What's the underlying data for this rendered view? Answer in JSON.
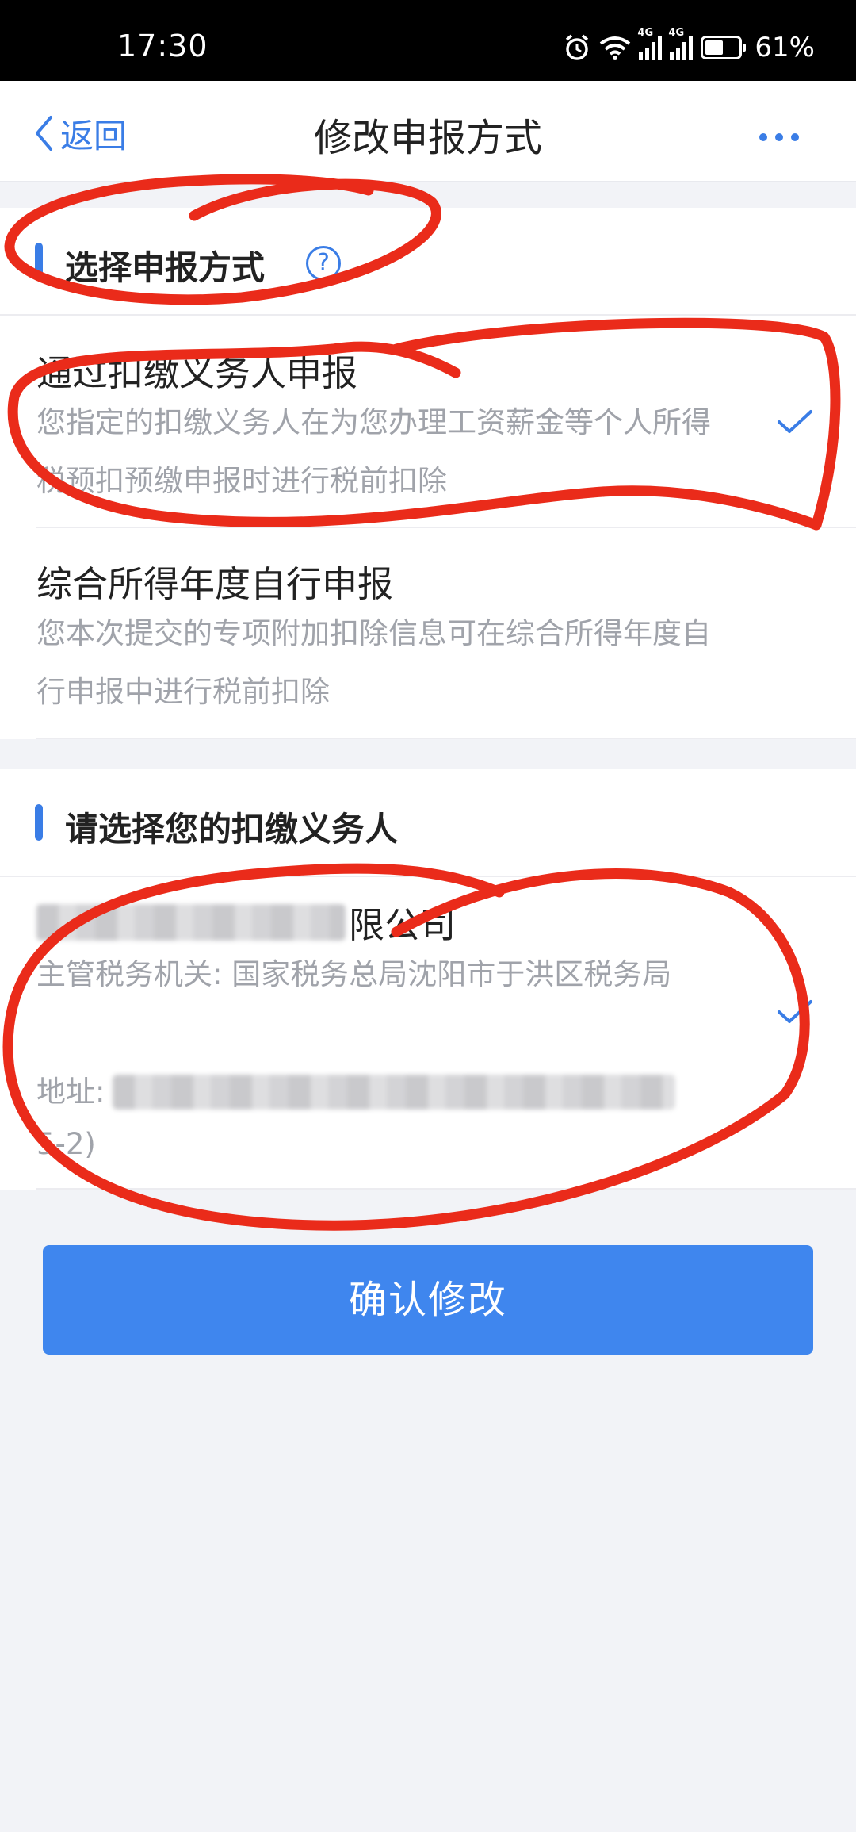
{
  "status_bar": {
    "time": "17:30",
    "network_label_1": "4G",
    "network_label_2": "4G",
    "battery": "61%"
  },
  "nav": {
    "back_label": "返回",
    "title": "修改申报方式"
  },
  "section_method": {
    "title": "选择申报方式",
    "help_glyph": "?",
    "options": [
      {
        "title": "通过扣缴义务人申报",
        "desc": "您指定的扣缴义务人在为您办理工资薪金等个人所得税预扣预缴申报时进行税前扣除",
        "selected": true
      },
      {
        "title": "综合所得年度自行申报",
        "desc": "您本次提交的专项附加扣除信息可在综合所得年度自行申报中进行税前扣除",
        "selected": false
      }
    ]
  },
  "section_withholder": {
    "title": "请选择您的扣缴义务人",
    "company_name_tail": "限公司",
    "tax_office_label": "主管税务机关:",
    "tax_office_value": "国家税务总局沈阳市于洪区税务局",
    "address_label": "地址:",
    "address_tail": "5-2)",
    "selected": true
  },
  "confirm_button": {
    "label": "确认修改"
  },
  "colors": {
    "accent": "#3a7de6",
    "button": "#3f86ee",
    "annotation": "#ea2b1a",
    "background": "#f2f3f7"
  }
}
